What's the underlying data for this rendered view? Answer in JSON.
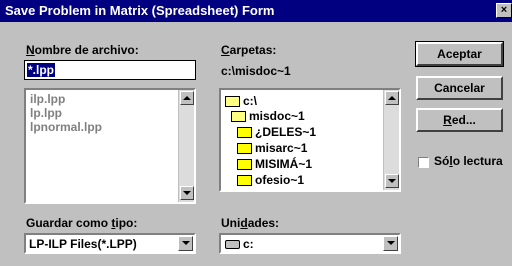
{
  "window": {
    "title": "Save Problem in Matrix (Spreadsheet) Form",
    "close_glyph": "×"
  },
  "filename": {
    "label_prefix": "",
    "label_u": "N",
    "label_rest": "ombre de archivo:",
    "value": "*.lpp",
    "list": [
      "ilp.lpp",
      "lp.lpp",
      "lpnormal.lpp"
    ]
  },
  "folders": {
    "label_u": "C",
    "label_rest": "arpetas:",
    "current_path": "c:\\misdoc~1",
    "tree": [
      {
        "name": "c:\\",
        "state": "open"
      },
      {
        "name": "misdoc~1",
        "state": "open"
      },
      {
        "name": "¿DELES~1",
        "state": "closed"
      },
      {
        "name": "misarc~1",
        "state": "closed"
      },
      {
        "name": "MISIMÁ~1",
        "state": "closed"
      },
      {
        "name": "ofesio~1",
        "state": "closed"
      }
    ]
  },
  "buttons": {
    "accept": "Aceptar",
    "cancel": "Cancelar",
    "network_u": "R",
    "network_rest": "ed..."
  },
  "readonly": {
    "label_pre": "Só",
    "label_u": "l",
    "label_post": "o lectura",
    "checked": false
  },
  "save_type": {
    "label_pre": "Guardar como ",
    "label_u": "t",
    "label_post": "ipo:",
    "value": "LP-ILP Files(*.LPP)"
  },
  "drives": {
    "label_pre": "Uni",
    "label_u": "d",
    "label_post": "ades:",
    "value": "c:"
  },
  "colors": {
    "titlebar": "#000080",
    "face": "#c0c0c0",
    "folder": "#ffff00"
  }
}
